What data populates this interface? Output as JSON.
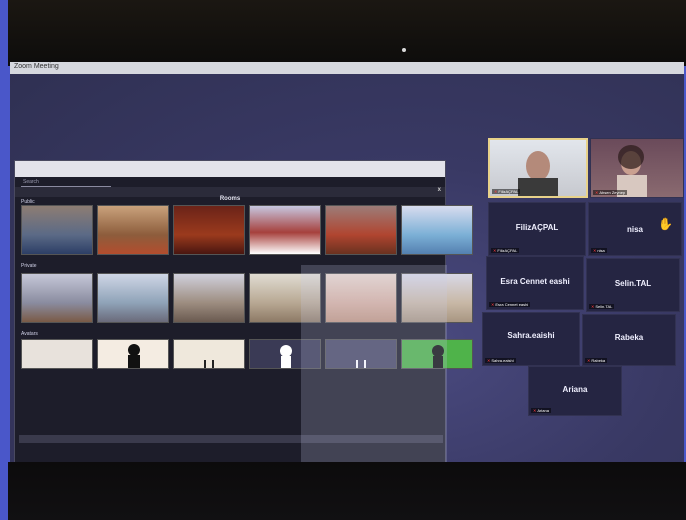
{
  "window": {
    "title": "Zoom Meeting"
  },
  "picker": {
    "search_placeholder": "Search",
    "title": "Rooms",
    "close_label": "x",
    "sections": [
      {
        "label": "Public",
        "thumbs": [
          "scene-1",
          "scene-2",
          "scene-3",
          "scene-4",
          "scene-5",
          "scene-6"
        ]
      },
      {
        "label": "Private",
        "thumbs": [
          "scene-7",
          "scene-8",
          "scene-9",
          "scene-10",
          "scene-11",
          "scene-12"
        ]
      },
      {
        "label": "Avatars",
        "thumbs": [
          "avatar-1",
          "avatar-2",
          "avatar-3",
          "avatar-4",
          "avatar-5",
          "avatar-6"
        ]
      }
    ]
  },
  "participants": [
    {
      "name": "FilizAÇPAL",
      "tag": "FilizAÇPAL",
      "video": true
    },
    {
      "name": "Ahsen Zeynep",
      "tag": "Ahsen Zeynep",
      "video": true
    },
    {
      "name": "FilizAÇPAL",
      "tag": "FilizAÇPAL",
      "video": false
    },
    {
      "name": "nisa",
      "tag": "nisa",
      "video": false,
      "hand": true
    },
    {
      "name": "Esra Cennet eashi",
      "tag": "Esra Cennet eashi",
      "video": false
    },
    {
      "name": "Selin.TAL",
      "tag": "Selin.TAL",
      "video": false
    },
    {
      "name": "Sahra.eaishi",
      "tag": "Sahra.eaishi",
      "video": false
    },
    {
      "name": "Rabeka",
      "tag": "Rabeka",
      "video": false
    },
    {
      "name": "Ariana",
      "tag": "Ariana",
      "video": false
    }
  ],
  "colors": {
    "accent": "#4a57c9",
    "active_speaker": "#e8d28a",
    "mic_muted": "#ff3a3a"
  }
}
